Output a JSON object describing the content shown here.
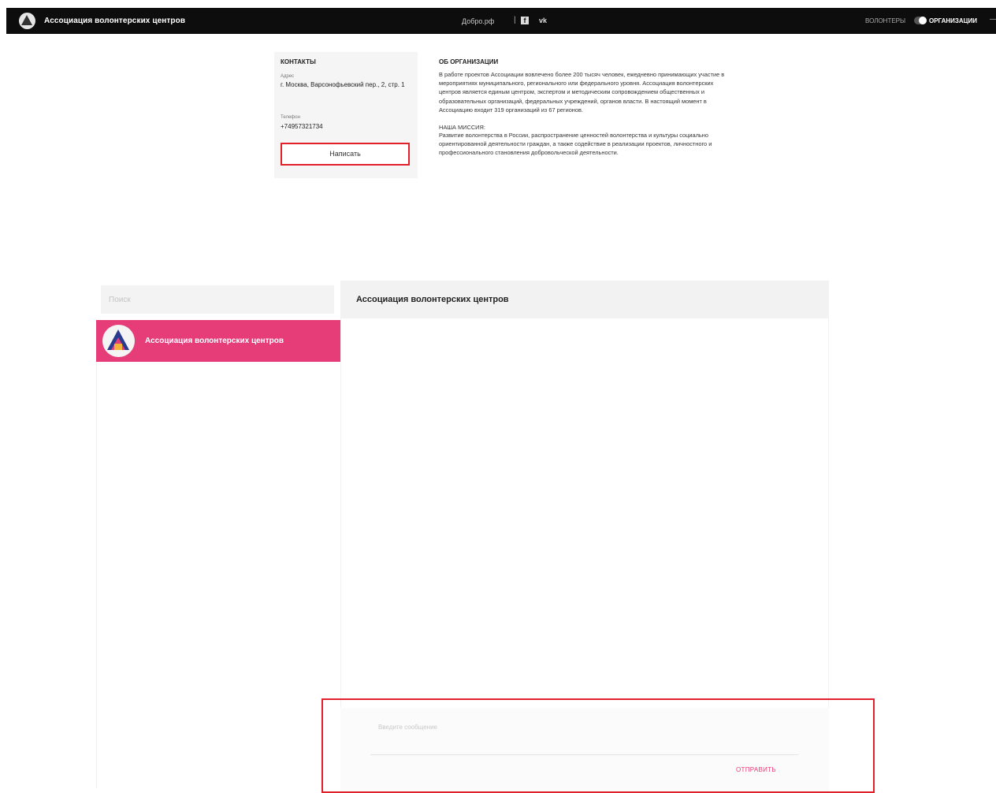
{
  "topbar": {
    "brand": "Ассоциация волонтерских центров",
    "site": "Добро.рф",
    "separator": "|",
    "fb_icon": "f",
    "vk_icon": "vk",
    "lang_label": "ВОЛОНТЕРЫ",
    "lang_value": "ОРГАНИЗАЦИИ",
    "dash": "—"
  },
  "contacts": {
    "heading": "КОНТАКТЫ",
    "address_label": "Адрес",
    "address": "г. Москва, Варсонофьевский пер., 2, стр. 1",
    "phone_label": "Телефон",
    "phone": "+74957321734",
    "write_button": "Написать"
  },
  "about": {
    "heading": "ОБ ОРГАНИЗАЦИИ",
    "text": "В работе проектов Ассоциации вовлечено более 200 тысяч человек, ежедневно принимающих участие в мероприятиях муниципального, регионального или федерального уровня. Ассоциация волонтерских центров является единым центром, экспертом и методическим сопровождением общественных и образовательных организаций, федеральных учреждений, органов власти. В настоящий момент в Ассоциацию входит 319 организаций из 67 регионов.",
    "mission_heading": "НАША МИССИЯ:",
    "mission_text": "Развитие волонтерства в России, распространение ценностей волонтерства и культуры социально ориентированной деятельности граждан, а также содействие в реализации проектов, личностного и профессионального становления добровольческой деятельности."
  },
  "chat": {
    "search_placeholder": "Поиск",
    "contact_name": "Ассоциация волонтерских центров",
    "header_title": "Ассоциация волонтерских центров",
    "message_placeholder": "Введите сообщение",
    "send_button": "ОТПРАВИТЬ"
  },
  "colors": {
    "accent": "#e63c78",
    "highlight": "#e0212b",
    "topbar": "#0d0d0d"
  }
}
